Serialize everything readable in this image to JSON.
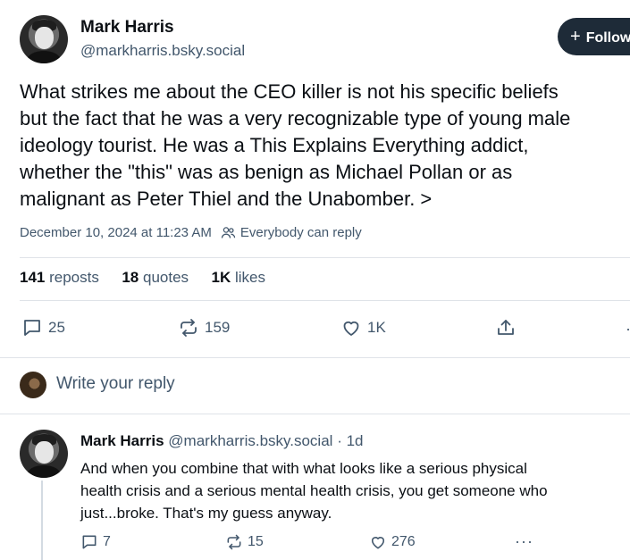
{
  "post": {
    "author_name": "Mark Harris",
    "author_handle": "@markharris.bsky.social",
    "follow_label": "Follow",
    "text_lines": [
      "What strikes me about the CEO killer is not his specific beliefs",
      "but the fact that he was a very recognizable type of young male",
      "ideology tourist. He was a This Explains Everything addict,",
      "whether the \"this\" was as benign as Michael Pollan or as",
      "malignant as Peter Thiel and the Unabomber. >"
    ],
    "timestamp": "December 10, 2024 at 11:23 AM",
    "reply_setting": "Everybody can reply",
    "stats": {
      "reposts_count": "141",
      "reposts_label": "reposts",
      "quotes_count": "18",
      "quotes_label": "quotes",
      "likes_count": "1K",
      "likes_label": "likes"
    },
    "actions": {
      "replies": "25",
      "reposts": "159",
      "likes": "1K"
    }
  },
  "composer": {
    "placeholder": "Write your reply"
  },
  "reply": {
    "author_name": "Mark Harris",
    "author_handle": "@markharris.bsky.social",
    "age": "· 1d",
    "text_lines": [
      "And when you combine that with what looks like a serious physical",
      "health crisis and a serious mental health crisis, you get someone who",
      "just...broke. That's my guess anyway."
    ],
    "actions": {
      "replies": "7",
      "reposts": "15",
      "likes": "276"
    }
  },
  "colors": {
    "text": "#0b0f14",
    "muted": "#42576c",
    "follow_bg": "#1e2b38",
    "divider": "#dfe3e8"
  }
}
